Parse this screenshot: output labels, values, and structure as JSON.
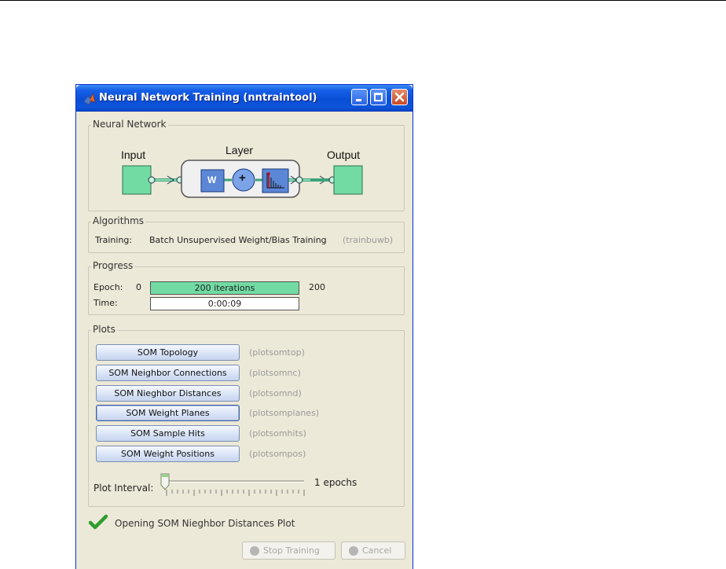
{
  "window": {
    "title": "Neural Network Training (nntraintool)"
  },
  "neural_network": {
    "section_title": "Neural Network",
    "input_label": "Input",
    "layer_label": "Layer",
    "output_label": "Output",
    "weight_symbol": "W",
    "sum_symbol": "+"
  },
  "algorithms": {
    "section_title": "Algorithms",
    "training_label": "Training:",
    "training_value": "Batch Unsupervised Weight/Bias Training",
    "training_fn": "(trainbuwb)"
  },
  "progress": {
    "section_title": "Progress",
    "epoch_label": "Epoch:",
    "epoch_start": "0",
    "epoch_bar_text": "200 iterations",
    "epoch_end": "200",
    "epoch_fraction": 1.0,
    "time_label": "Time:",
    "time_value": "0:00:09"
  },
  "plots": {
    "section_title": "Plots",
    "buttons": [
      {
        "label": "SOM Topology",
        "fn": "(plotsomtop)"
      },
      {
        "label": "SOM Neighbor Connections",
        "fn": "(plotsomnc)"
      },
      {
        "label": "SOM Nieghbor Distances",
        "fn": "(plotsomnd)"
      },
      {
        "label": "SOM Weight Planes",
        "fn": "(plotsomplanes)"
      },
      {
        "label": "SOM Sample Hits",
        "fn": "(plotsomhits)"
      },
      {
        "label": "SOM Weight Positions",
        "fn": "(plotsompos)"
      }
    ],
    "interval_label": "Plot Interval:",
    "interval_value": "1 epochs"
  },
  "status": {
    "message": "Opening SOM Nieghbor Distances Plot",
    "icon": "check-icon",
    "color": "#2e9c2e"
  },
  "footer": {
    "stop_label": "Stop Training",
    "cancel_label": "Cancel"
  },
  "colors": {
    "titlebar": "#0a4fd6",
    "node_fill": "#71dba3",
    "window_bg": "#ece9d8"
  }
}
